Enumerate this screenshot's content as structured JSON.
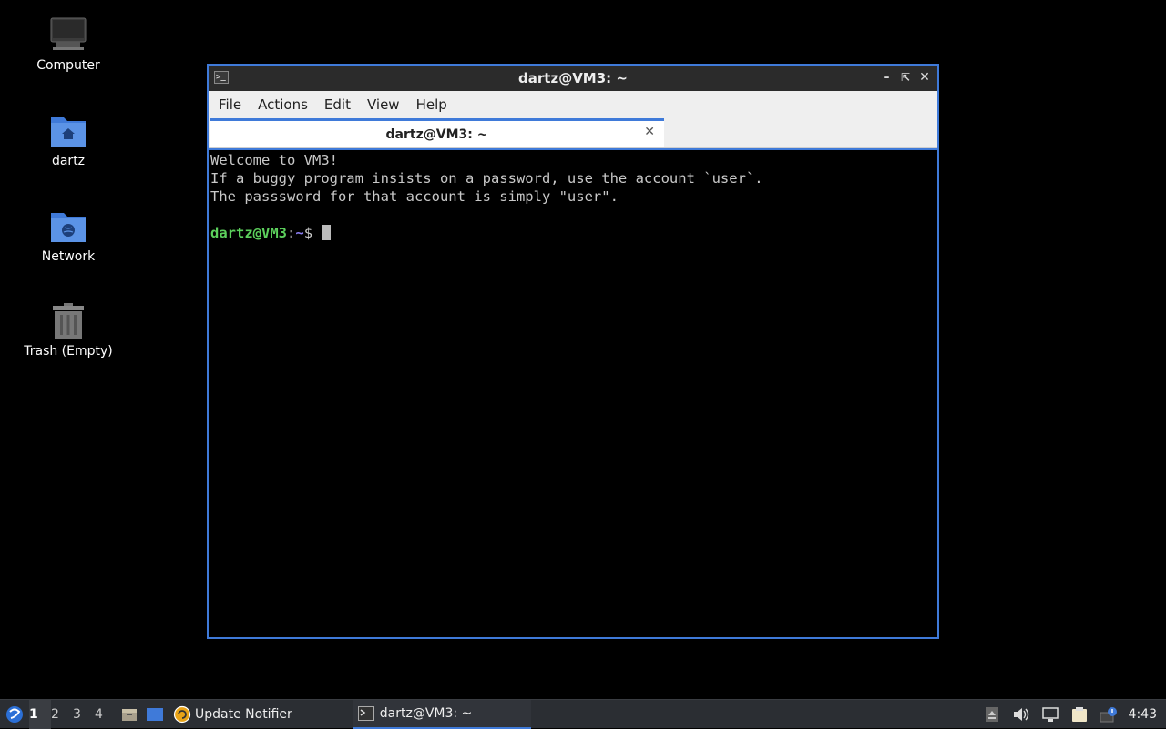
{
  "desktop": {
    "icons": [
      {
        "label": "Computer"
      },
      {
        "label": "dartz"
      },
      {
        "label": "Network"
      },
      {
        "label": "Trash (Empty)"
      }
    ]
  },
  "window": {
    "title": "dartz@VM3: ~",
    "menu": [
      "File",
      "Actions",
      "Edit",
      "View",
      "Help"
    ],
    "tab": {
      "label": "dartz@VM3: ~"
    },
    "terminal": {
      "lines": [
        "Welcome to VM3!",
        "If a buggy program insists on a password, use the account `user`.",
        "The passsword for that account is simply \"user\"."
      ],
      "prompt_user": "dartz@VM3",
      "prompt_sep": ":",
      "prompt_path": "~",
      "prompt_symbol": "$"
    }
  },
  "taskbar": {
    "workspaces": [
      "1",
      "2",
      "3",
      "4"
    ],
    "active_workspace": "1",
    "tasks": [
      {
        "label": "Update Notifier",
        "icon": "update-notifier-icon"
      },
      {
        "label": "dartz@VM3: ~",
        "icon": "terminal-icon"
      }
    ],
    "clock": "4:43"
  },
  "colors": {
    "accent": "#3f7ad9",
    "prompt_user": "#5cd05c",
    "prompt_path": "#8a7df0"
  }
}
